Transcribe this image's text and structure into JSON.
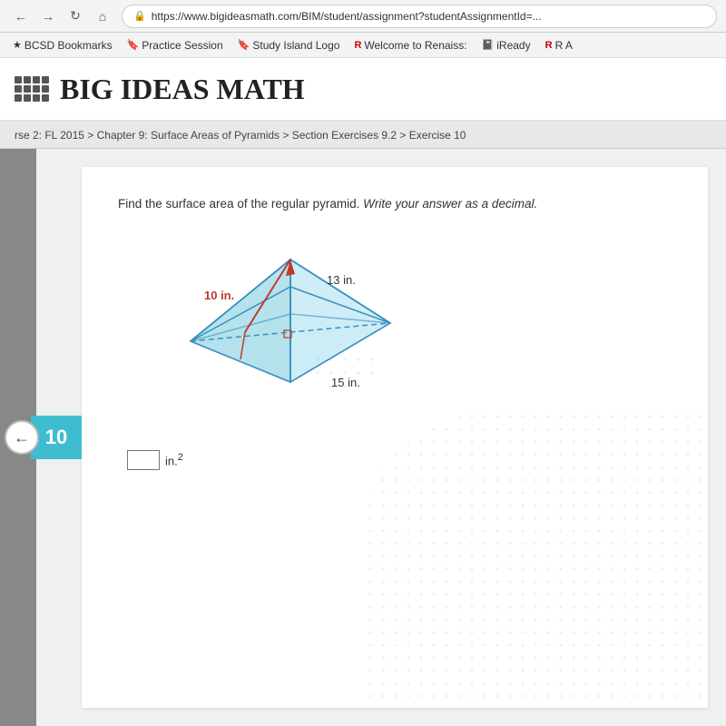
{
  "browser": {
    "url": "https://www.bigideasmath.com/BIM/student/assignment?studentAssignmentId=...",
    "nav": {
      "back": "←",
      "forward": "→",
      "refresh": "↺",
      "home": "⌂"
    },
    "bookmarks": [
      {
        "label": "BCSD Bookmarks",
        "icon": "★"
      },
      {
        "label": "Practice Session",
        "icon": "🔖"
      },
      {
        "label": "Study Island Logo",
        "icon": "🔖"
      },
      {
        "label": "Welcome to Renaiss:",
        "icon": "R"
      },
      {
        "label": "iReady",
        "icon": "📋"
      },
      {
        "label": "R A",
        "icon": "R"
      }
    ]
  },
  "header": {
    "title": "BIG IDEAS MATH",
    "grid_label": "grid-icon"
  },
  "breadcrumb": {
    "text": "rse 2: FL 2015 > Chapter 9: Surface Areas of Pyramids > Section Exercises 9.2 > Exercise 10"
  },
  "exercise": {
    "number": "10",
    "question": "Find the surface area of the regular pyramid. Write your answer as a decimal.",
    "question_italic": "Write your answer as a decimal.",
    "labels": {
      "side1": "10 in.",
      "side2": "13 in.",
      "base": "15 in."
    },
    "answer_unit": "in.²",
    "answer_superscript": "2",
    "answer_unit_base": "in."
  },
  "back_button": {
    "icon": "←"
  }
}
